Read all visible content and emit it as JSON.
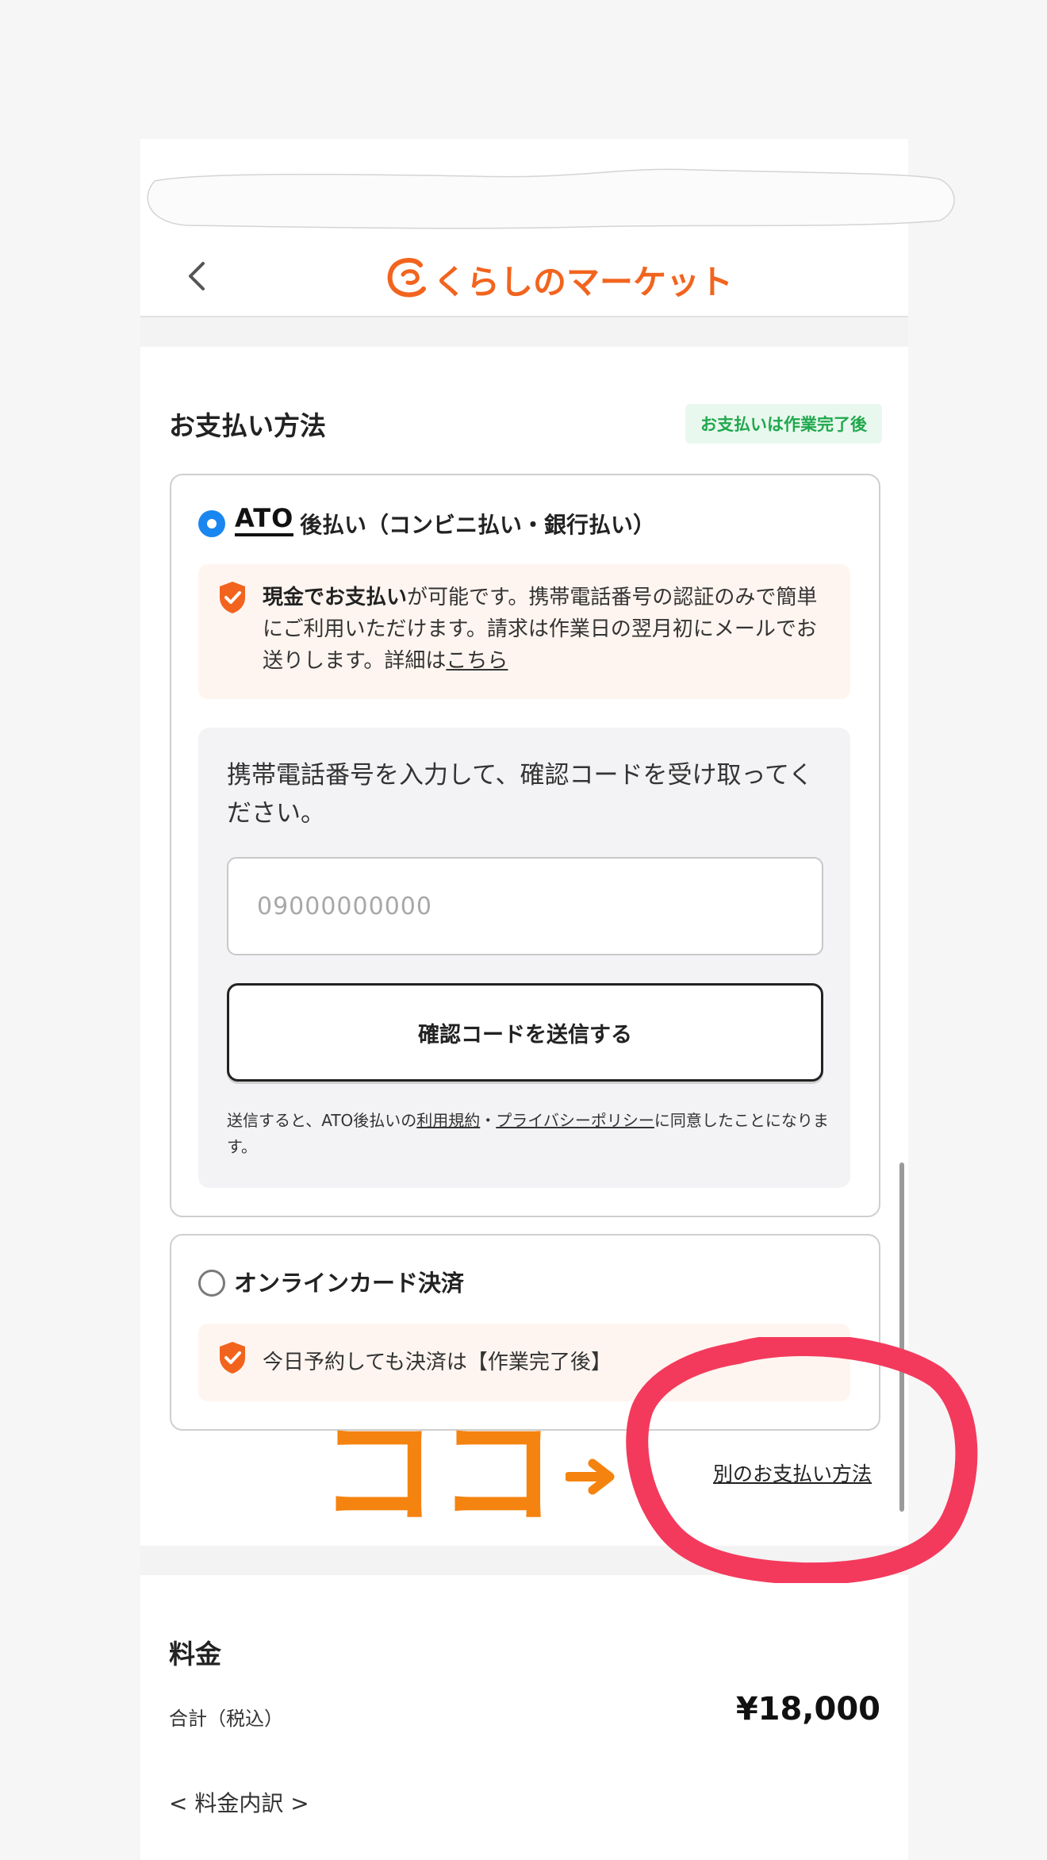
{
  "header": {
    "back_label": "<",
    "logo_text": "くらしのマーケット",
    "brand_color": "#f2641e"
  },
  "payment": {
    "section_title": "お支払い方法",
    "status_badge": "お支払いは作業完了後",
    "ato_option": {
      "selected": true,
      "logo": "ATO",
      "label": "後払い（コンビニ払い・銀行払い）",
      "notice_bold": "現金でお支払い",
      "notice_text": "が可能です。携帯電話番号の認証のみで簡単にご利用いただけます。請求は作業日の翌月初にメールでお送りします。詳細は",
      "notice_link": "こちら",
      "verify_instruction": "携帯電話番号を入力して、確認コードを受け取ってください。",
      "phone_placeholder": "09000000000",
      "send_button": "確認コードを送信する",
      "terms_prefix": "送信すると、ATO後払いの",
      "terms_link": "利用規約",
      "terms_sep": "・",
      "privacy_link": "プライバシーポリシー",
      "terms_suffix": "に同意したことになります。"
    },
    "card_option": {
      "selected": false,
      "label": "オンラインカード決済",
      "notice": "今日予約しても決済は【作業完了後】"
    },
    "alt_method_link": "別のお支払い方法"
  },
  "fee": {
    "title": "料金",
    "total_label": "合計（税込）",
    "total_value": "¥18,000",
    "breakdown_label": "< 料金内訳 >"
  },
  "annotation": {
    "text": "ココ",
    "arrow_color": "#f5830f",
    "circle_color": "#f33a5c"
  }
}
